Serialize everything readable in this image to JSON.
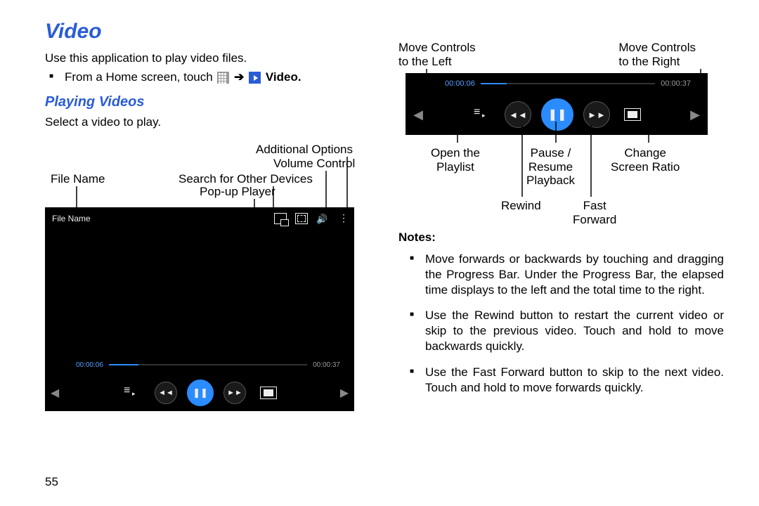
{
  "left": {
    "title": "Video",
    "intro": "Use this application to play video files.",
    "step_prefix": "From a Home screen, touch ",
    "step_suffix": "Video",
    "subheading": "Playing Videos",
    "select_line": "Select a video to play.",
    "labels": {
      "file_name": "File Name",
      "search_devices": "Search for Other Devices",
      "popup_player": "Pop-up Player",
      "additional_options": "Additional Options",
      "volume_control": "Volume Control"
    },
    "screenshot": {
      "file_label": "File Name",
      "elapsed": "00:00:06",
      "total": "00:00:37"
    },
    "page_number": "55"
  },
  "right": {
    "labels": {
      "move_left": "Move Controls\nto the Left",
      "move_right": "Move Controls\nto the Right",
      "open_playlist": "Open the\nPlaylist",
      "pause_resume": "Pause /\nResume\nPlayback",
      "change_ratio": "Change\nScreen Ratio",
      "rewind": "Rewind",
      "fast_forward": "Fast\nForward"
    },
    "strip": {
      "elapsed": "00:00:06",
      "total": "00:00:37"
    },
    "notes_heading": "Notes:",
    "notes": [
      "Move forwards or backwards by touching and dragging the Progress Bar. Under the Progress Bar, the elapsed time displays to the left and the total time to the right.",
      "Use the Rewind button to restart the current video or skip to the previous video. Touch and hold to move backwards quickly.",
      "Use the Fast Forward button to skip to the next video. Touch and hold to move forwards quickly."
    ]
  }
}
